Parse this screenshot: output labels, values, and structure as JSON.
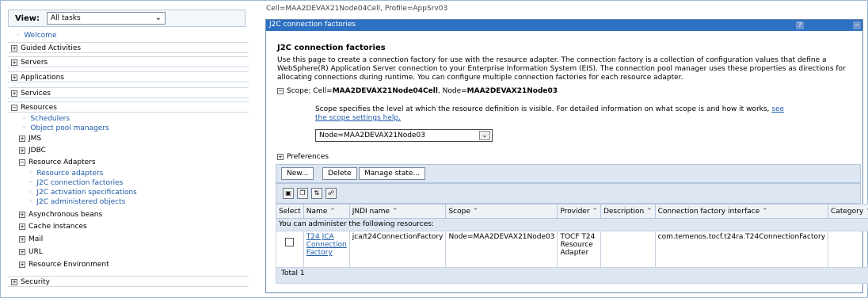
{
  "nav": {
    "view_label": "View:",
    "view_value": "All tasks",
    "welcome": "Welcome",
    "sections": [
      {
        "label": "Guided Activities",
        "state": "+"
      },
      {
        "label": "Servers",
        "state": "+"
      },
      {
        "label": "Applications",
        "state": "+"
      },
      {
        "label": "Services",
        "state": "+"
      },
      {
        "label": "Resources",
        "state": "−"
      }
    ],
    "resources_links": [
      "Schedulers",
      "Object pool managers"
    ],
    "resources_groups_top": [
      {
        "label": "JMS",
        "state": "+"
      },
      {
        "label": "JDBC",
        "state": "+"
      },
      {
        "label": "Resource Adapters",
        "state": "−"
      }
    ],
    "adapter_links": [
      "Resource adapters",
      "J2C connection factories",
      "J2C activation specifications",
      "J2C administered objects"
    ],
    "resources_groups_bottom": [
      {
        "label": "Asynchronous beans",
        "state": "+"
      },
      {
        "label": "Cache instances",
        "state": "+"
      },
      {
        "label": "Mail",
        "state": "+"
      },
      {
        "label": "URL",
        "state": "+"
      },
      {
        "label": "Resource Environment",
        "state": "+"
      }
    ],
    "security": {
      "label": "Security",
      "state": "+"
    }
  },
  "content": {
    "cell_profile": "Cell=MAA2DEVAX21Node04Cell, Profile=AppSrv03",
    "panel_title": "J2C connection factories",
    "help_symbol": "?",
    "min_symbol": "−",
    "page_title": "J2C connection factories",
    "description": "Use this page to create a connection factory for use with the resource adapter. The connection factory is a collection of configuration values that define a WebSphere(R) Application Server connection to your Enterprise Information System (EIS). The connection pool manager uses these properties as directions for allocating connections during runtime. You can configure multiple connection factories for each resource adapter.",
    "scope_toggle": "−",
    "scope_prefix": "Scope: Cell=",
    "scope_cell": "MAA2DEVAX21Node04Cell",
    "scope_mid": ", Node=",
    "scope_node": "MAA2DEVAX21Node03",
    "scope_desc": "Scope specifies the level at which the resource definition is visible. For detailed information on what scope is and how it works,",
    "scope_link": "see the scope settings help.",
    "scope_select_value": "Node=MAA2DEVAX21Node03",
    "prefs_toggle": "+",
    "preferences": "Preferences",
    "buttons": {
      "new": "New...",
      "delete": "Delete",
      "manage": "Manage state..."
    },
    "columns": [
      "Select",
      "Name",
      "JNDI name",
      "Scope",
      "Provider",
      "Description",
      "Connection factory interface",
      "Category"
    ],
    "admin_text": "You can administer the following resources:",
    "rows": [
      {
        "name": "T24 JCA Connection Factory",
        "jndi": "jca/t24ConnectionFactory",
        "scope": "Node=MAA2DEVAX21Node03",
        "provider": "TOCF T24 Resource Adapter",
        "description": "",
        "interface": "com.temenos.tocf.t24ra.T24ConnectionFactory",
        "category": ""
      }
    ],
    "total": "Total 1"
  }
}
